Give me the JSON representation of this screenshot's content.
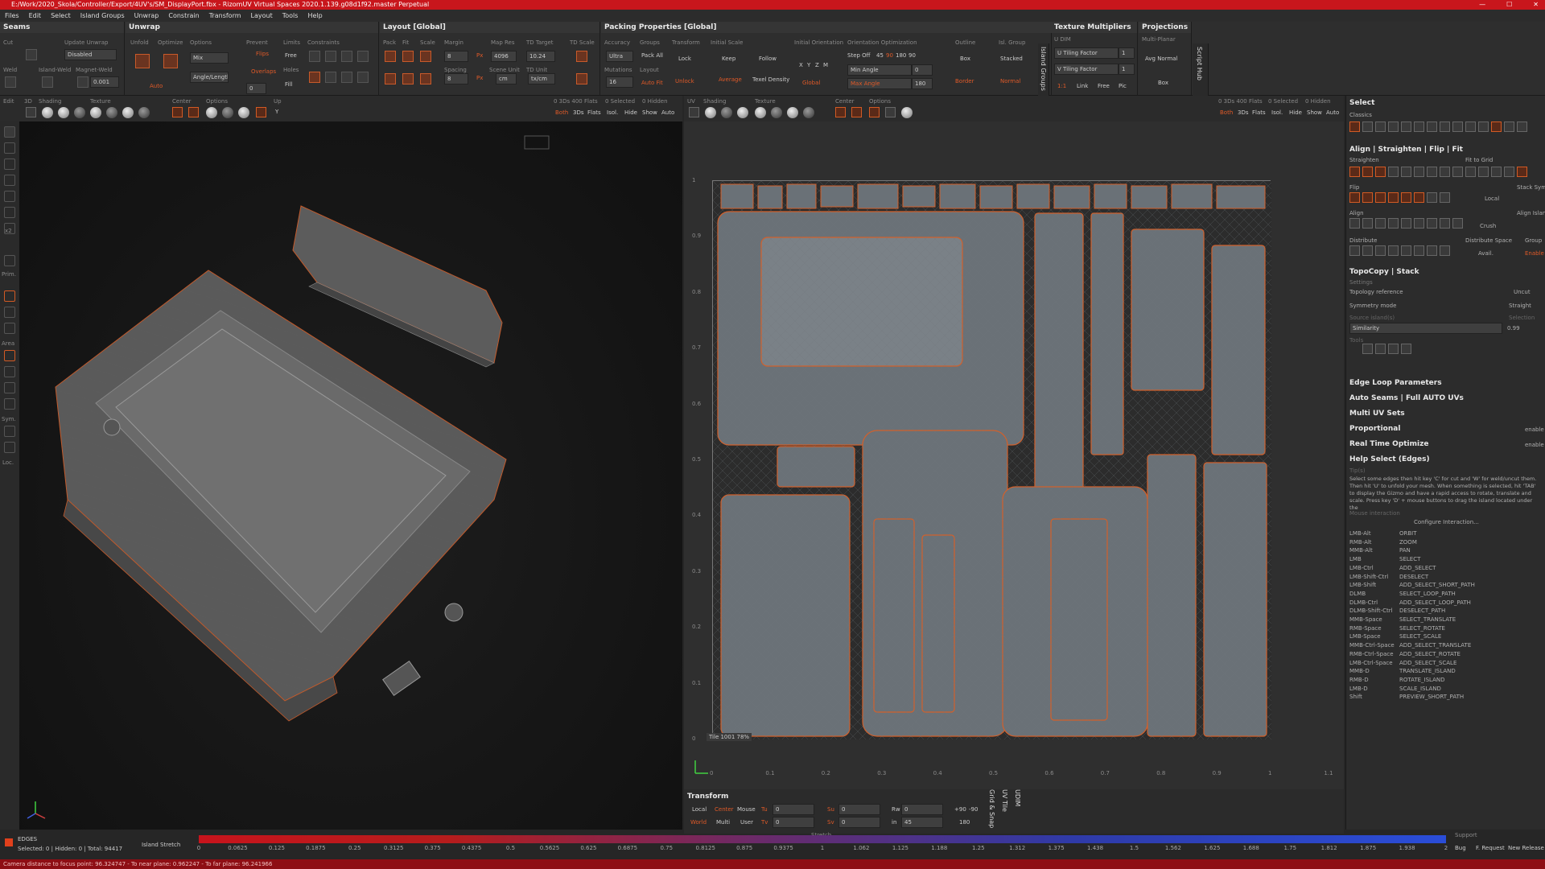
{
  "window": {
    "title": "E:/Work/2020_Skola/Controller/Export/4UV's/SM_DisplayPort.fbx - RizomUV  Virtual Spaces 2020.1.139.g08d1f92.master Perpetual"
  },
  "menu": [
    "Files",
    "Edit",
    "Select",
    "Island Groups",
    "Unwrap",
    "Constrain",
    "Transform",
    "Layout",
    "Tools",
    "Help"
  ],
  "seams": {
    "title": "Seams",
    "cut": "Cut",
    "weld": "Weld",
    "island_weld": "Island-Weld",
    "magnet_weld": "Magnet-Weld",
    "magnet_val": "0.001",
    "update_unwrap": "Update Unwrap",
    "update_val": "Disabled"
  },
  "unwrap": {
    "title": "Unwrap",
    "unfold": "Unfold",
    "optimize": "Optimize",
    "options": "Options",
    "auto": "Auto",
    "mode": "Mix",
    "angle": "Angle/Length",
    "angle_val": "0",
    "prevent": "Prevent",
    "flips": "Flips",
    "overlaps": "Overlaps",
    "limits": "Limits",
    "free": "Free",
    "holes": "Holes",
    "fill": "Fill",
    "constraints": "Constraints"
  },
  "layout": {
    "title": "Layout [Global]",
    "pack": "Pack",
    "fit": "Fit",
    "scale": "Scale",
    "margin": "Margin",
    "margin_val": "8",
    "spacing": "Spacing",
    "spacing_val": "8",
    "px": "Px",
    "map_res": "Map Res",
    "map_val": "4096",
    "scene_unit": "Scene Unit",
    "scene_val": "cm",
    "td_target": "TD Target",
    "td_val": "10.24",
    "td_unit": "TD Unit",
    "td_unit_val": "tx/cm",
    "td_scale": "TD Scale"
  },
  "packing": {
    "title": "Packing Properties [Global]",
    "accuracy": "Accuracy",
    "accuracy_val": "Ultra",
    "groups": "Groups",
    "pack_all": "Pack All",
    "transform": "Transform",
    "lock": "Lock",
    "unlock": "Unlock",
    "mutations": "Mutations",
    "mutations_val": "16",
    "layout": "Layout",
    "auto_fit": "Auto Fit",
    "initial_scale": "Initial Scale",
    "keep": "Keep",
    "follow": "Follow",
    "average": "Average",
    "texel_density": "Texel Density",
    "initial_orientation": "Initial Orientation",
    "orientation_optimization": "Orientation Optimization",
    "step_off": "Step Off",
    "step_vals": [
      "45",
      "90",
      "180",
      "90"
    ],
    "min_angle": "Min Angle",
    "min_angle_val": "0",
    "max_angle": "Max Angle",
    "max_angle_val": "180",
    "global": "Global",
    "outline": "Outline",
    "box": "Box",
    "border": "Border",
    "isl_group": "Isl. Group",
    "stacked": "Stacked",
    "normal": "Normal",
    "xyz": [
      "X",
      "Y",
      "Z",
      "M"
    ]
  },
  "texmult": {
    "title": "Texture Multipliers",
    "udim": "U DIM",
    "u_tiling": "U Tiling Factor",
    "u_val": "1",
    "v_tiling": "V Tiling Factor",
    "v_val": "1",
    "link_val": "1:1",
    "link": "Link",
    "free": "Free",
    "pic": "Pic"
  },
  "projections": {
    "title": "Projections",
    "multi_planar": "Multi-Planar",
    "avg_normal": "Avg Normal",
    "box": "Box"
  },
  "vtabs": {
    "island_groups": "Island Groups",
    "script_hub": "Script Hub"
  },
  "toolbar3d": {
    "shading": "Shading",
    "texture": "Texture",
    "center": "Center",
    "options": "Options",
    "up": "Up",
    "up_val": "Y",
    "stats": "0 3Ds 400 Flats",
    "selected": "0 Selected",
    "hidden": "0 Hidden",
    "both": "Both",
    "3ds": "3Ds",
    "flats": "Flats",
    "isol": "Isol.",
    "hide": "Hide",
    "show": "Show",
    "auto": "Auto",
    "edit": "Edit",
    "3d": "3D"
  },
  "toolbaruv": {
    "uv": "UV",
    "shading": "Shading",
    "texture": "Texture",
    "center": "Center",
    "options": "Options",
    "stats": "0 3Ds 400 Flats",
    "selected": "0 Selected",
    "hidden": "0 Hidden",
    "both": "Both",
    "3ds": "3Ds",
    "flats": "Flats",
    "isol": "Isol.",
    "hide": "Hide",
    "show": "Show",
    "auto": "Auto"
  },
  "lefttools": {
    "x2": "x2",
    "prim": "Prim.",
    "area": "Area",
    "sym": "Sym.",
    "loc": "Loc."
  },
  "uvview": {
    "tile_label": "Tile 1001 78%",
    "v_ticks": [
      "1",
      "0.9",
      "0.8",
      "0.7",
      "0.6",
      "0.5",
      "0.4",
      "0.3",
      "0.2",
      "0.1",
      "0"
    ],
    "u_ticks": [
      "0",
      "0.1",
      "0.2",
      "0.3",
      "0.4",
      "0.5",
      "0.6",
      "0.7",
      "0.8",
      "0.9",
      "1",
      "1.1"
    ]
  },
  "rightpanel": {
    "select": "Select",
    "classics": "Classics",
    "align": "Align | Straighten | Flip | Fit",
    "straighten": "Straighten",
    "fit_to_grid": "Fit to Grid",
    "flip": "Flip",
    "local": "Local",
    "stack_sym": "Stack Sym.",
    "align_label": "Align",
    "crush": "Crush",
    "align_island": "Align Island",
    "distribute": "Distribute",
    "distribute_space": "Distribute Space",
    "group": "Group",
    "avail": "Avail.",
    "enable": "Enable",
    "topocopy": "TopoCopy | Stack",
    "settings": "Settings",
    "topology_reference": "Topology reference",
    "topo_val": "Uncut",
    "symmetry_mode": "Symmetry mode",
    "sym_val": "Straight",
    "source_islands": "Source island(s)",
    "selection": "Selection",
    "similarity": "Similarity",
    "similarity_val": "0.99",
    "tools": "Tools",
    "edge_loop": "Edge Loop Parameters",
    "auto_seams": "Auto Seams | Full AUTO UVs",
    "multi_uv": "Multi UV Sets",
    "proportional": "Proportional",
    "real_time": "Real Time Optimize",
    "enable_small": "enable",
    "help": "Help Select (Edges)",
    "tip": "Tip(s)",
    "help_text": "Select some edges then hit key 'C' for cut and 'W' for weld/uncut them. Then hit 'U' to unfold your mesh. When something is selected, hit 'TAB' to display the Gizmo and have a rapid access to rotate, translate and scale. Press key 'D' + mouse buttons to drag the island located under the",
    "mouse_interaction": "Mouse interaction",
    "configure": "Configure Interaction...",
    "shortcuts": [
      [
        "LMB-Alt",
        "ORBIT"
      ],
      [
        "RMB-Alt",
        "ZOOM"
      ],
      [
        "MMB-Alt",
        "PAN"
      ],
      [
        "LMB",
        "SELECT"
      ],
      [
        "LMB-Ctrl",
        "ADD_SELECT"
      ],
      [
        "LMB-Shift-Ctrl",
        "DESELECT"
      ],
      [
        "LMB-Shift",
        "ADD_SELECT_SHORT_PATH"
      ],
      [
        "DLMB",
        "SELECT_LOOP_PATH"
      ],
      [
        "DLMB-Ctrl",
        "ADD_SELECT_LOOP_PATH"
      ],
      [
        "DLMB-Shift-Ctrl",
        "DESELECT_PATH"
      ],
      [
        "MMB-Space",
        "SELECT_TRANSLATE"
      ],
      [
        "RMB-Space",
        "SELECT_ROTATE"
      ],
      [
        "LMB-Space",
        "SELECT_SCALE"
      ],
      [
        "MMB-Ctrl-Space",
        "ADD_SELECT_TRANSLATE"
      ],
      [
        "RMB-Ctrl-Space",
        "ADD_SELECT_ROTATE"
      ],
      [
        "LMB-Ctrl-Space",
        "ADD_SELECT_SCALE"
      ],
      [
        "MMB-D",
        "TRANSLATE_ISLAND"
      ],
      [
        "RMB-D",
        "ROTATE_ISLAND"
      ],
      [
        "LMB-D",
        "SCALE_ISLAND"
      ],
      [
        "Shift",
        "PREVIEW_SHORT_PATH"
      ]
    ]
  },
  "transform": {
    "title": "Transform",
    "local": "Local",
    "center": "Center",
    "mouse": "Mouse",
    "tu": "Tu",
    "tu_val": "0",
    "su": "Su",
    "su_val": "0",
    "rw": "Rw",
    "rw_val": "0",
    "plus90": "+90",
    "minus90": "-90",
    "world": "World",
    "multi": "Multi",
    "user": "User",
    "tv": "Tv",
    "tv_val": "0",
    "sv": "Sv",
    "sv_val": "0",
    "in": "in",
    "in_val": "45",
    "v180": "180",
    "tabs": [
      "Grid & Snap",
      "UV Tile",
      "UDIM"
    ]
  },
  "bottom": {
    "mode": "EDGES",
    "selected": "Selected: 0 | Hidden: 0 | Total: 94417",
    "island_stretch": "Island Stretch",
    "stretch": "Stretch",
    "support": "Support",
    "bug": "Bug",
    "f_request": "F. Request",
    "new_release": "New Release",
    "ticks": [
      "0",
      "0.0625",
      "0.125",
      "0.1875",
      "0.25",
      "0.3125",
      "0.375",
      "0.4375",
      "0.5",
      "0.5625",
      "0.625",
      "0.6875",
      "0.75",
      "0.8125",
      "0.875",
      "0.9375",
      "1",
      "1.062",
      "1.125",
      "1.188",
      "1.25",
      "1.312",
      "1.375",
      "1.438",
      "1.5",
      "1.562",
      "1.625",
      "1.688",
      "1.75",
      "1.812",
      "1.875",
      "1.938",
      "2"
    ]
  },
  "status": "Camera distance to focus point: 96.324747 - To near plane: 0.962247 - To far plane: 96.241966"
}
